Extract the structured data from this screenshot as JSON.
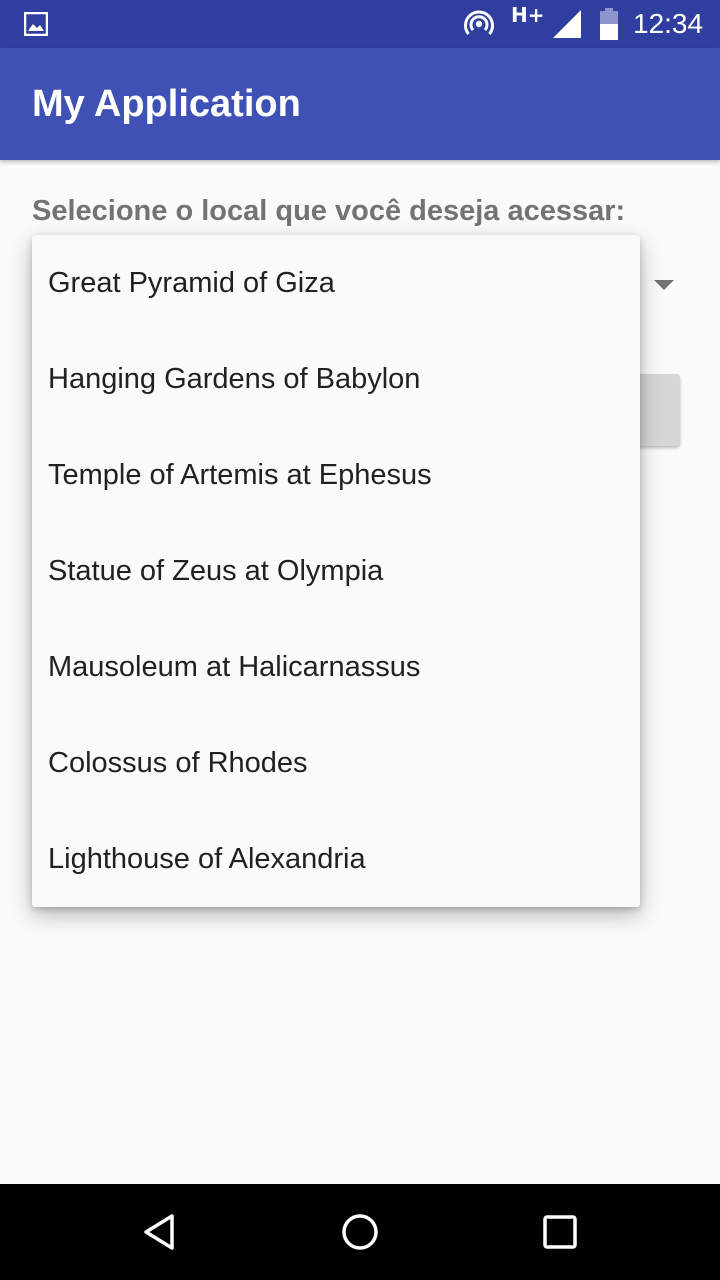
{
  "status_bar": {
    "time": "12:34",
    "network_type": "H+",
    "icons": [
      "gallery-icon",
      "hotspot-icon",
      "signal-icon",
      "battery-icon"
    ]
  },
  "app_bar": {
    "title": "My Application",
    "color": "#3f51b5",
    "status_color": "#303f9f"
  },
  "content": {
    "prompt_label": "Selecione o local que você deseja acessar:"
  },
  "dropdown": {
    "options": [
      "Great Pyramid of Giza",
      "Hanging Gardens of Babylon",
      "Temple of Artemis at Ephesus",
      "Statue of Zeus at Olympia",
      "Mausoleum at Halicarnassus",
      "Colossus of Rhodes",
      "Lighthouse of Alexandria"
    ]
  },
  "nav_bar": {
    "icons": [
      "back-icon",
      "home-icon",
      "recents-icon"
    ]
  }
}
